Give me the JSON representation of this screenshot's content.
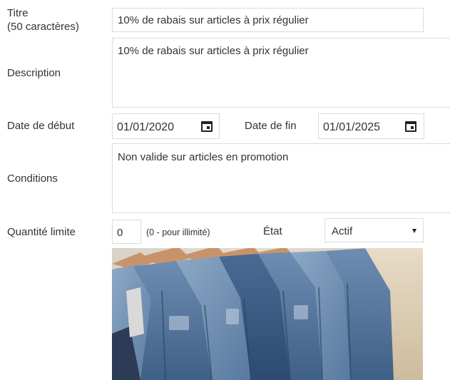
{
  "form": {
    "title_label_line1": "Titre",
    "title_label_line2": "(50 caractères)",
    "title_value": "10% de rabais sur articles à prix régulier",
    "description_label": "Description",
    "description_value": "10% de rabais sur articles à prix régulier",
    "start_date_label": "Date de début",
    "start_date_value": "01/01/2020",
    "end_date_label": "Date de fin",
    "end_date_value": "01/01/2025",
    "conditions_label": "Conditions",
    "conditions_value": "Non valide sur articles en promotion",
    "quantity_label": "Quantité limite",
    "quantity_value": "0",
    "quantity_hint": "(0 - pour illimité)",
    "state_label": "État",
    "state_value": "Actif"
  },
  "icons": {
    "start_date": "calendar-icon",
    "end_date": "calendar-icon",
    "state_select": "chevron-down-icon"
  },
  "image": {
    "subject": "clothing-rack-photo"
  }
}
